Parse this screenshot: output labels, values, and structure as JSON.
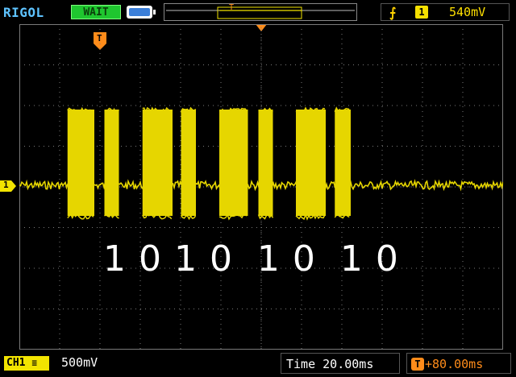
{
  "header": {
    "brand": "RIGOL",
    "run_status": "WAIT",
    "trigger_channel": "1",
    "trigger_level": "540mV"
  },
  "screen": {
    "ch1_marker": "1",
    "trigger_marker": "T",
    "decoded_bits": "1 0 1 0  1 0  1 0"
  },
  "footer": {
    "channel_tag": "CH1",
    "channel_scale": "500mV",
    "timebase": "Time 20.00ms",
    "trigger_offset": "+80.00ms"
  },
  "colors": {
    "trace": "#e6d600",
    "trigger_marker": "#ff8c1a",
    "grid": "#7a7a7a",
    "brand": "#5ec3ff",
    "status": "#1fc62f"
  },
  "signal": {
    "bursts": [
      {
        "start_ms": 23.9,
        "end_ms": 37.2
      },
      {
        "start_ms": 42.2,
        "end_ms": 49.4
      },
      {
        "start_ms": 61.1,
        "end_ms": 76.0
      },
      {
        "start_ms": 80.2,
        "end_ms": 87.6
      },
      {
        "start_ms": 99.2,
        "end_ms": 113.4
      },
      {
        "start_ms": 118.6,
        "end_ms": 125.8
      },
      {
        "start_ms": 137.2,
        "end_ms": 152.0
      },
      {
        "start_ms": 156.5,
        "end_ms": 164.4
      }
    ]
  }
}
